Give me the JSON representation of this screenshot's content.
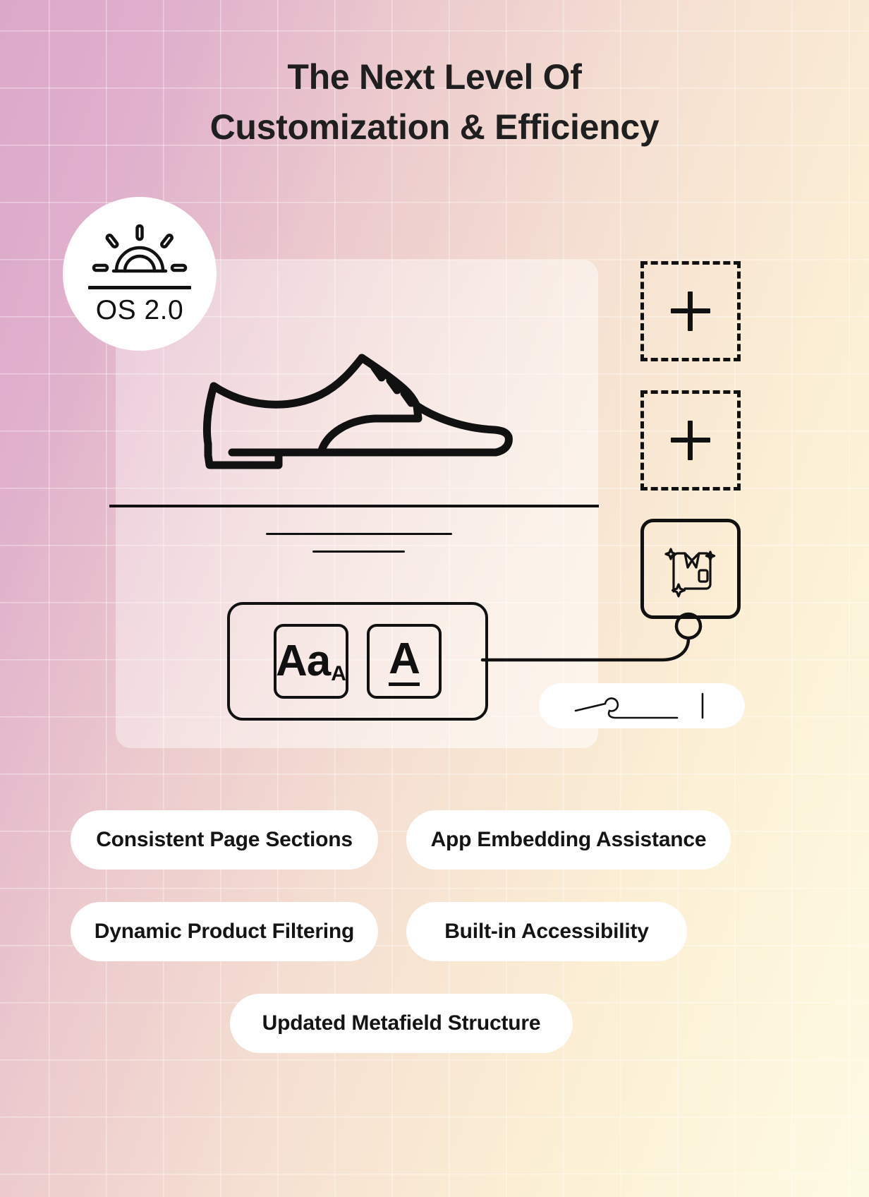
{
  "background": {
    "gradient_from": "#dca8ca",
    "gradient_to": "#fdfae4",
    "grid_color": "#ffffff"
  },
  "header": {
    "title_line1": "The Next Level Of",
    "title_line2": "Customization & Efficiency",
    "title_color": "#1f1f1f"
  },
  "badge": {
    "label": "OS 2.0",
    "icon": "sunrise-icon",
    "background": "#ffffff"
  },
  "canvas": {
    "product_icon": "dress-shoe-icon",
    "divider": "content-divider",
    "text_placeholder_lines": 2,
    "typography_panel": {
      "name": "typography-controls",
      "options": [
        {
          "label": "Aa",
          "name": "font-size-option",
          "underlined": false
        },
        {
          "label": "A",
          "name": "font-style-option",
          "underlined": true
        }
      ]
    }
  },
  "sidebar_tools": {
    "add_blocks": [
      {
        "name": "add-section-block-1",
        "label": "+"
      },
      {
        "name": "add-section-block-2",
        "label": "+"
      }
    ],
    "product_card": {
      "name": "shirt-product-card",
      "icon": "shirt-sparkle-icon"
    },
    "needle_pill": {
      "name": "needle-thread-pill",
      "icon": "needle-thread-icon"
    }
  },
  "features": [
    {
      "label": "Consistent Page Sections",
      "name": "feature-consistent-page-sections"
    },
    {
      "label": "App Embedding Assistance",
      "name": "feature-app-embedding-assistance"
    },
    {
      "label": "Dynamic Product Filtering",
      "name": "feature-dynamic-product-filtering"
    },
    {
      "label": "Built-in Accessibility",
      "name": "feature-built-in-accessibility"
    },
    {
      "label": "Updated Metafield Structure",
      "name": "feature-updated-metafield-structure"
    }
  ]
}
